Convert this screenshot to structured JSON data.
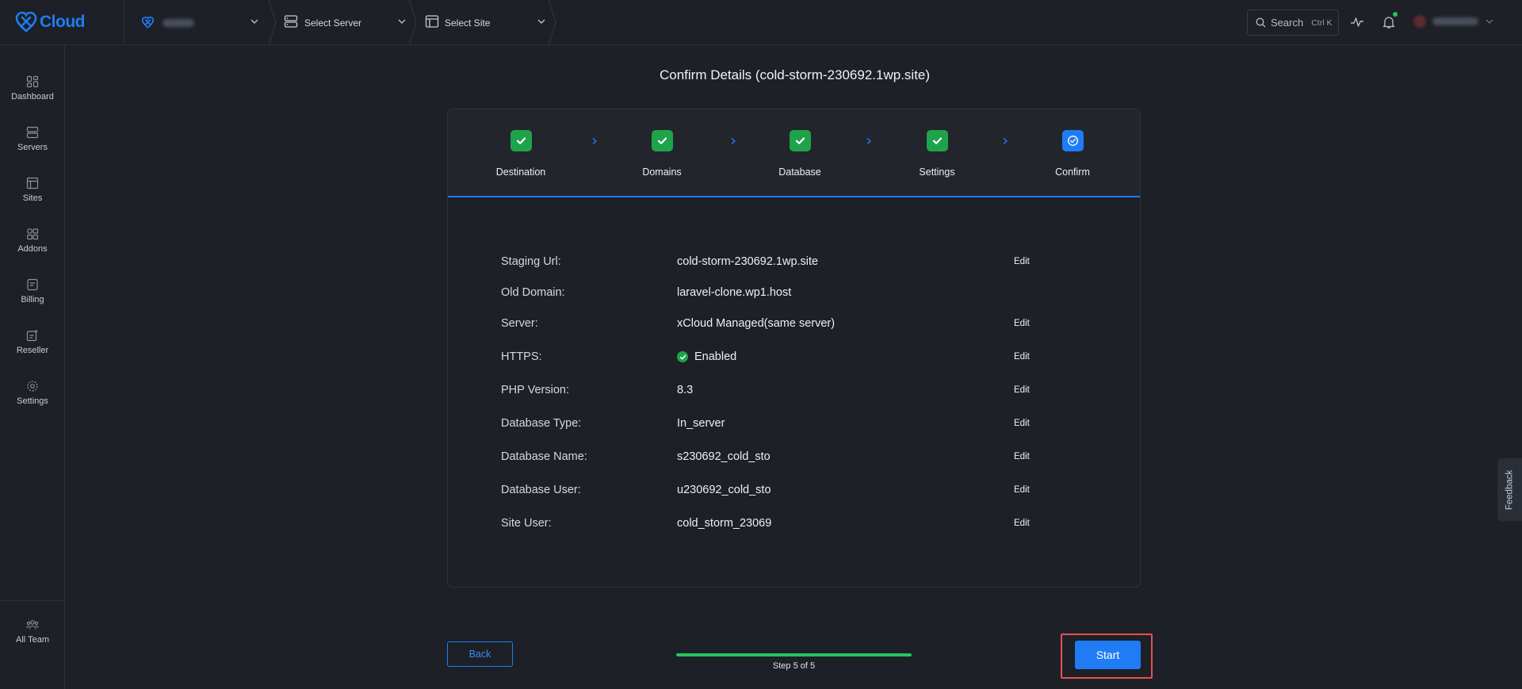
{
  "app": {
    "logo_text": "Cloud"
  },
  "topbar": {
    "team_selector_label": "",
    "server_selector_label": "Select Server",
    "site_selector_label": "Select Site",
    "search_label": "Search",
    "search_shortcut": "Ctrl K",
    "user_name": ""
  },
  "sidebar": {
    "items": [
      {
        "label": "Dashboard",
        "icon": "dashboard-icon"
      },
      {
        "label": "Servers",
        "icon": "server-icon"
      },
      {
        "label": "Sites",
        "icon": "sites-icon"
      },
      {
        "label": "Addons",
        "icon": "addons-icon"
      },
      {
        "label": "Billing",
        "icon": "billing-icon"
      },
      {
        "label": "Reseller",
        "icon": "reseller-icon"
      },
      {
        "label": "Settings",
        "icon": "gear-icon"
      }
    ],
    "bottom_item": {
      "label": "All Team",
      "icon": "team-icon"
    }
  },
  "main": {
    "title": "Confirm Details (cold-storm-230692.1wp.site)",
    "steps": [
      {
        "label": "Destination",
        "state": "done"
      },
      {
        "label": "Domains",
        "state": "done"
      },
      {
        "label": "Database",
        "state": "done"
      },
      {
        "label": "Settings",
        "state": "done"
      },
      {
        "label": "Confirm",
        "state": "current"
      }
    ],
    "details": [
      {
        "label": "Staging Url:",
        "value": "cold-storm-230692.1wp.site",
        "edit": "Edit"
      },
      {
        "label": "Old Domain:",
        "value": "laravel-clone.wp1.host",
        "edit": ""
      },
      {
        "label": "Server:",
        "value": "xCloud Managed(same server)",
        "edit": "Edit"
      },
      {
        "label": "HTTPS:",
        "value": "Enabled",
        "edit": "Edit"
      },
      {
        "label": "PHP Version:",
        "value": "8.3",
        "edit": "Edit"
      },
      {
        "label": "Database Type:",
        "value": "In_server",
        "edit": "Edit"
      },
      {
        "label": "Database Name:",
        "value": "s230692_cold_sto",
        "edit": "Edit"
      },
      {
        "label": "Database User:",
        "value": "u230692_cold_sto",
        "edit": "Edit"
      },
      {
        "label": "Site User:",
        "value": "cold_storm_23069",
        "edit": "Edit"
      }
    ]
  },
  "footer": {
    "back_label": "Back",
    "progress_text": "Step 5 of 5",
    "progress_fraction": 1.0,
    "start_label": "Start"
  },
  "feedback_label": "Feedback",
  "colors": {
    "accent": "#1f7cf5",
    "success": "#1fa34a",
    "highlight": "#e2534d",
    "background": "#1d2027"
  }
}
